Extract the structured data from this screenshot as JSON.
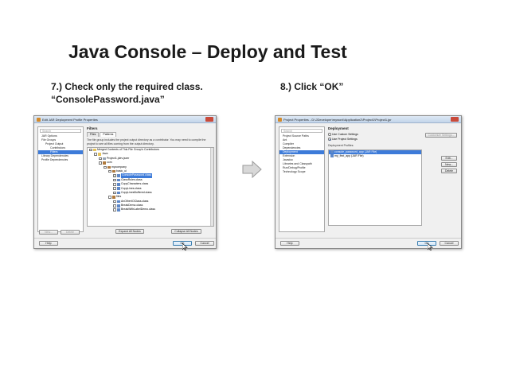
{
  "slide": {
    "title": "Java Console – Deploy and Test",
    "step7_line1": "7.) Check only the required class.",
    "step7_line2": "“ConsolePassword.java”",
    "step8": "8.) Click “OK”"
  },
  "dialog1": {
    "title": "Edit JAR Deployment Profile Properties",
    "search_placeholder": "Search",
    "nav": [
      "JAR Options",
      "File Groups",
      "Project Output",
      "Contributors",
      "Filters",
      "Library Dependencies",
      "Profile Dependencies"
    ],
    "section": "Filters",
    "tabs": [
      "Files",
      "Patterns"
    ],
    "description": "The file group includes the project output directory as a contributor. You may need to compile the project to see all files coming from the output directory.",
    "tree": [
      "Merged Contents of This File Group's Contributors",
      "Java",
      "Project1.jdev.jsxer",
      "com",
      "mycompany",
      "basic_ui",
      "ConsolePassword.class",
      "ClassRules.class",
      "CopyCharacters.class",
      "CopyLines.class",
      "CopyLinesBuffered.class",
      "files",
      "AnOtherIOClass.class",
      "BreakDemo.class",
      "BreakWithLabelDemo.class"
    ],
    "buttons": {
      "expand_all": "Expand All Nodes",
      "collapse_all": "Collapse All Nodes",
      "new": "New...",
      "delete": "Delete",
      "help": "Help",
      "ok": "OK",
      "cancel": "Cancel"
    }
  },
  "dialog2": {
    "title": "Project Properties - D:\\JDeveloper\\mywork\\Application2\\Project1\\Project1.jpr",
    "search_placeholder": "Search",
    "nav": [
      "Project Source Paths",
      "Ant",
      "Compiler",
      "Dependencies",
      "Deployment",
      "Extension",
      "Javadoc",
      "Libraries and Classpath",
      "Run/Debug/Profile",
      "Technology Scope"
    ],
    "section": "Deployment",
    "option_custom": "Use Custom Settings",
    "option_project": "Use Project Settings",
    "customize_button": "Customize Settings...",
    "list_label": "Deployment Profiles:",
    "profiles": [
      "console_password_app (JAR File)",
      "my_first_app (JAR File)"
    ],
    "buttons": {
      "edit": "Edit...",
      "new": "New...",
      "delete": "Delete",
      "help": "Help",
      "ok": "OK",
      "cancel": "Cancel"
    }
  },
  "colors": {
    "selection": "#3d7bd9",
    "arrow_fill": "#d8d8d8",
    "arrow_stroke": "#9a9a9a"
  }
}
